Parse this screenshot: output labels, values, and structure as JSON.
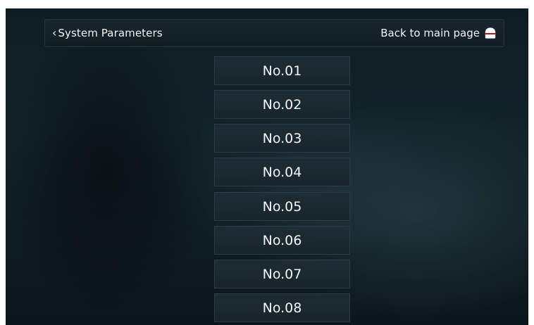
{
  "header": {
    "back_label": "System Parameters",
    "home_label": "Back to main page",
    "home_icon": "home-shutter-icon"
  },
  "items": [
    "No.01",
    "No.02",
    "No.03",
    "No.04",
    "No.05",
    "No.06",
    "No.07",
    "No.08"
  ],
  "colors": {
    "background": "#0e1c23",
    "panel": "#18262d",
    "border": "#2a3d46",
    "text": "#f4f7f8"
  }
}
